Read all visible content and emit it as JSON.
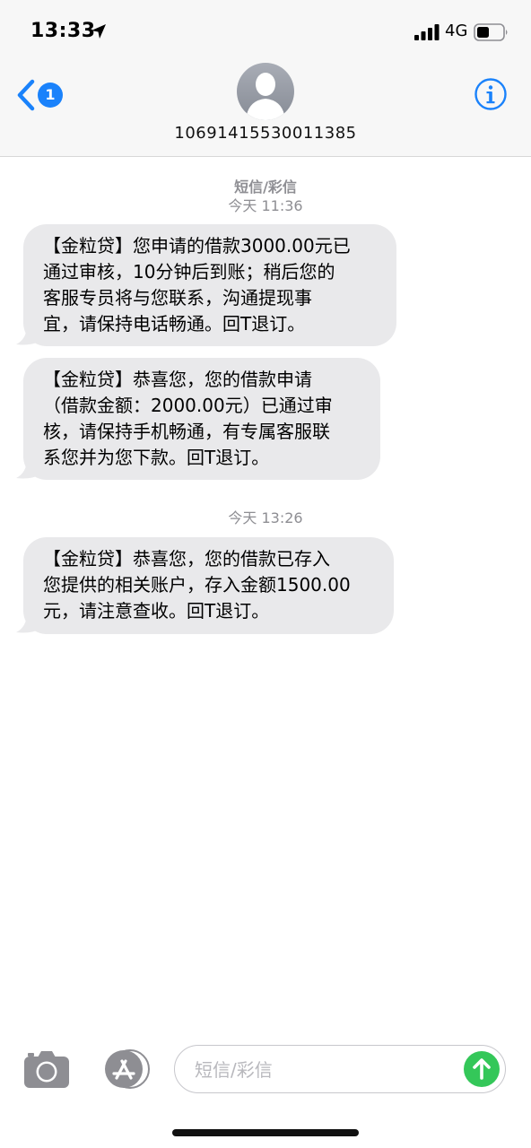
{
  "status_bar": {
    "time": "13:33",
    "network": "4G"
  },
  "header": {
    "back_badge": "1",
    "contact": "10691415530011385",
    "icons": {
      "back": "chevron-left-icon",
      "avatar": "person-silhouette-icon",
      "info": "info-icon"
    }
  },
  "conversation": {
    "service_label": "短信/彩信",
    "timestamp_1": "今天 11:36",
    "timestamp_2": "今天 13:26",
    "messages": [
      {
        "text": "【金粒贷】您申请的借款3000.00元已\n通过审核，10分钟后到账；稍后您的\n客服专员将与您联系，沟通提现事\n宜，请保持电话畅通。回T退订。"
      },
      {
        "text": "【金粒贷】恭喜您，您的借款申请\n（借款金额：2000.00元）已通过审\n核，请保持手机畅通，有专属客服联\n系您并为您下款。回T退订。"
      },
      {
        "text": "【金粒贷】恭喜您，您的借款已存入\n您提供的相关账户，存入金额1500.00\n元，请注意查收。回T退订。"
      }
    ]
  },
  "composer": {
    "placeholder": "短信/彩信",
    "icons": {
      "camera": "camera-icon",
      "apps": "app-store-icon",
      "send": "send-arrow-icon"
    }
  },
  "colors": {
    "accent": "#1a82fb",
    "bubble": "#e9e9eb",
    "send": "#34c759",
    "meta_text": "#8e8e93"
  }
}
